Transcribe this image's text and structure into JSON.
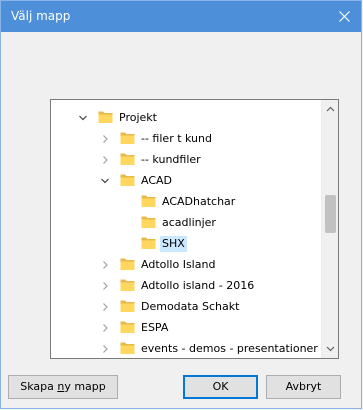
{
  "window": {
    "title": "Välj mapp",
    "close_icon": "close-icon",
    "accent_color": "#4d8fd9"
  },
  "tree": {
    "items": [
      {
        "label": "Projekt",
        "level": 0,
        "expanded": true,
        "selected": false
      },
      {
        "label": "-- filer t kund",
        "level": 1,
        "expanded": false,
        "selected": false
      },
      {
        "label": "-- kundfiler",
        "level": 1,
        "expanded": false,
        "selected": false
      },
      {
        "label": "ACAD",
        "level": 1,
        "expanded": true,
        "selected": false
      },
      {
        "label": "ACADhatchar",
        "level": 2,
        "expanded": false,
        "selected": false
      },
      {
        "label": "acadlinjer",
        "level": 2,
        "expanded": false,
        "selected": false
      },
      {
        "label": "SHX",
        "level": 2,
        "expanded": false,
        "selected": true
      },
      {
        "label": "Adtollo Island",
        "level": 1,
        "expanded": false,
        "selected": false
      },
      {
        "label": "Adtollo island - 2016",
        "level": 1,
        "expanded": false,
        "selected": false
      },
      {
        "label": "Demodata Schakt",
        "level": 1,
        "expanded": false,
        "selected": false
      },
      {
        "label": "ESPA",
        "level": 1,
        "expanded": false,
        "selected": false
      },
      {
        "label": "events - demos - presentationer",
        "level": 1,
        "expanded": false,
        "selected": false
      }
    ],
    "selection_color": "#cce8ff",
    "folder_color": "#ffd75e"
  },
  "buttons": {
    "new_folder_prefix": "Skapa ",
    "new_folder_underlined": "n",
    "new_folder_suffix": "y mapp",
    "ok_label": "OK",
    "cancel_label": "Avbryt"
  }
}
